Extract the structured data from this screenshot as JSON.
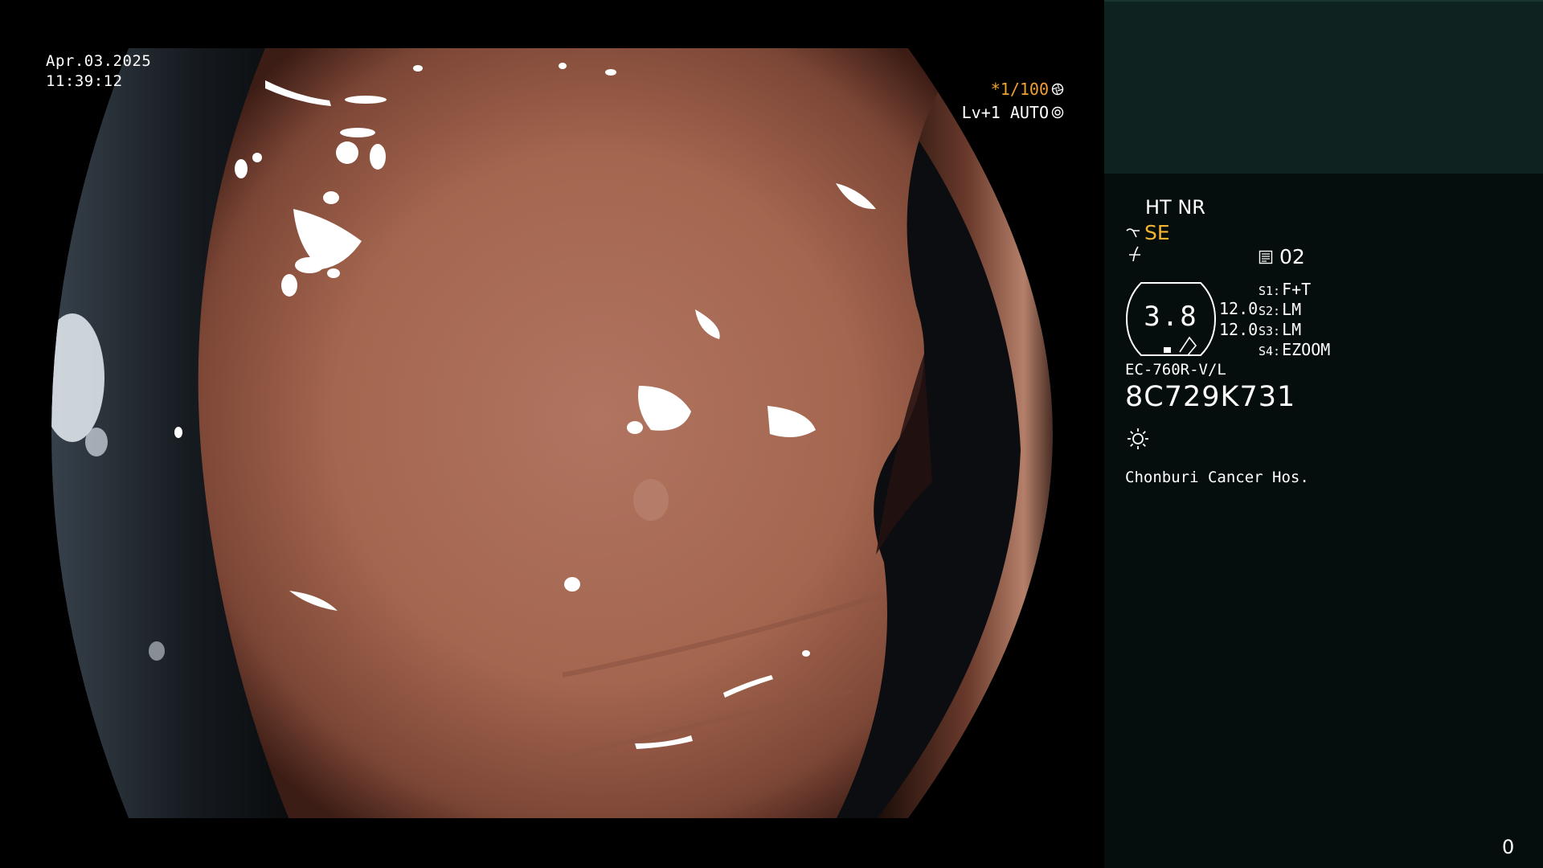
{
  "overlay": {
    "date": "Apr.03.2025",
    "time": "11:39:12",
    "shutter": "*1/100",
    "level": "Lv+1 AUTO"
  },
  "panel": {
    "ht_nr": "HT NR",
    "se": "SE",
    "book_value": "02",
    "oct_value": "3.8",
    "value_a": "12.0",
    "value_b": "12.0",
    "switches": [
      {
        "key": "S1:",
        "value": "F+T"
      },
      {
        "key": "S2:",
        "value": "LM"
      },
      {
        "key": "S3:",
        "value": "LM"
      },
      {
        "key": "S4:",
        "value": "EZOOM"
      }
    ],
    "scope_model": "EC-760R-V/L",
    "serial": "8C729K731",
    "hospital": "Chonburi Cancer Hos.",
    "counter": "0"
  },
  "colors": {
    "accent_orange": "#f0a030",
    "accent_yellow": "#f4b432",
    "panel_bg": "#050e0c",
    "panel_top_bg": "#0e2220",
    "tissue": "#a86a54"
  },
  "icons": [
    "aperture-icon",
    "iris-icon",
    "light-wave-icon",
    "fiber-icon",
    "book-icon",
    "brightness-icon"
  ]
}
